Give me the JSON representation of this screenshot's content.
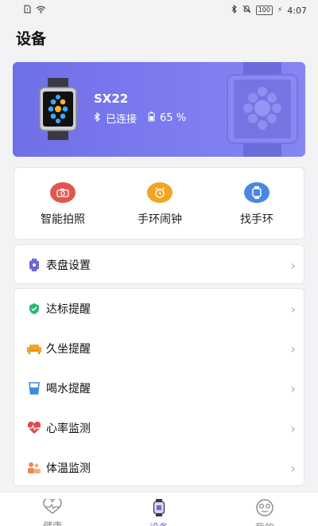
{
  "status_bar": {
    "time": "4:07",
    "battery": "100"
  },
  "page_title": "设备",
  "device": {
    "name": "SX22",
    "connection": "已连接",
    "battery": "65 %"
  },
  "quick_actions": [
    {
      "label": "智能拍照",
      "icon": "camera-icon",
      "color": "#e0574f"
    },
    {
      "label": "手环闹钟",
      "icon": "alarm-clock-icon",
      "color": "#f0a623"
    },
    {
      "label": "找手环",
      "icon": "band-icon",
      "color": "#4a86e8"
    }
  ],
  "dial_setting": {
    "label": "表盘设置",
    "icon": "watch-face-icon"
  },
  "settings": [
    {
      "label": "达标提醒",
      "icon": "shield-check-icon",
      "color": "#2bb673"
    },
    {
      "label": "久坐提醒",
      "icon": "sofa-icon",
      "color": "#f0a623"
    },
    {
      "label": "喝水提醒",
      "icon": "cup-icon",
      "color": "#3b8be5"
    },
    {
      "label": "心率监测",
      "icon": "heart-rate-icon",
      "color": "#e04a4a"
    },
    {
      "label": "体温监测",
      "icon": "temperature-icon",
      "color": "#e88a55"
    }
  ],
  "bottom_nav": [
    {
      "label": "健康",
      "icon": "heart-icon"
    },
    {
      "label": "设备",
      "icon": "watch-icon",
      "active": true
    },
    {
      "label": "我的",
      "icon": "profile-icon"
    }
  ]
}
